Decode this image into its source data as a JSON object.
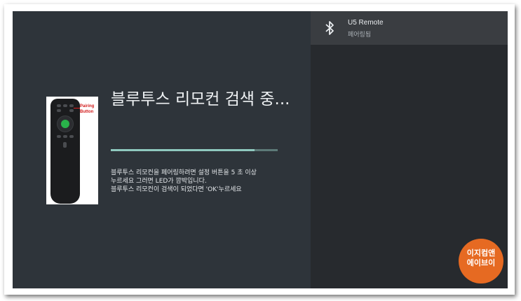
{
  "device_panel": {
    "device_name": "U5 Remote",
    "device_status": "페어링됨",
    "icon": "bluetooth-icon"
  },
  "search": {
    "title": "블루투스 리모컨 검색 중...",
    "progress_fraction": 0.86,
    "instructions": [
      "블루투스 리모컨을 페어링하려면 설정 버튼을 5 초 이상",
      "누르세요 그러면 LED가 깜박입니다.",
      "블루투스 리모컨이 검색이 되었다면 'OK'누르세요"
    ]
  },
  "remote_image": {
    "pairing_label": "Pairing Button"
  },
  "watermark": {
    "line1": "이지컴앤",
    "line2": "에이브이"
  },
  "colors": {
    "accent": "#8fc9bf",
    "ok_button": "#29b24a",
    "badge": "#e66a22"
  }
}
